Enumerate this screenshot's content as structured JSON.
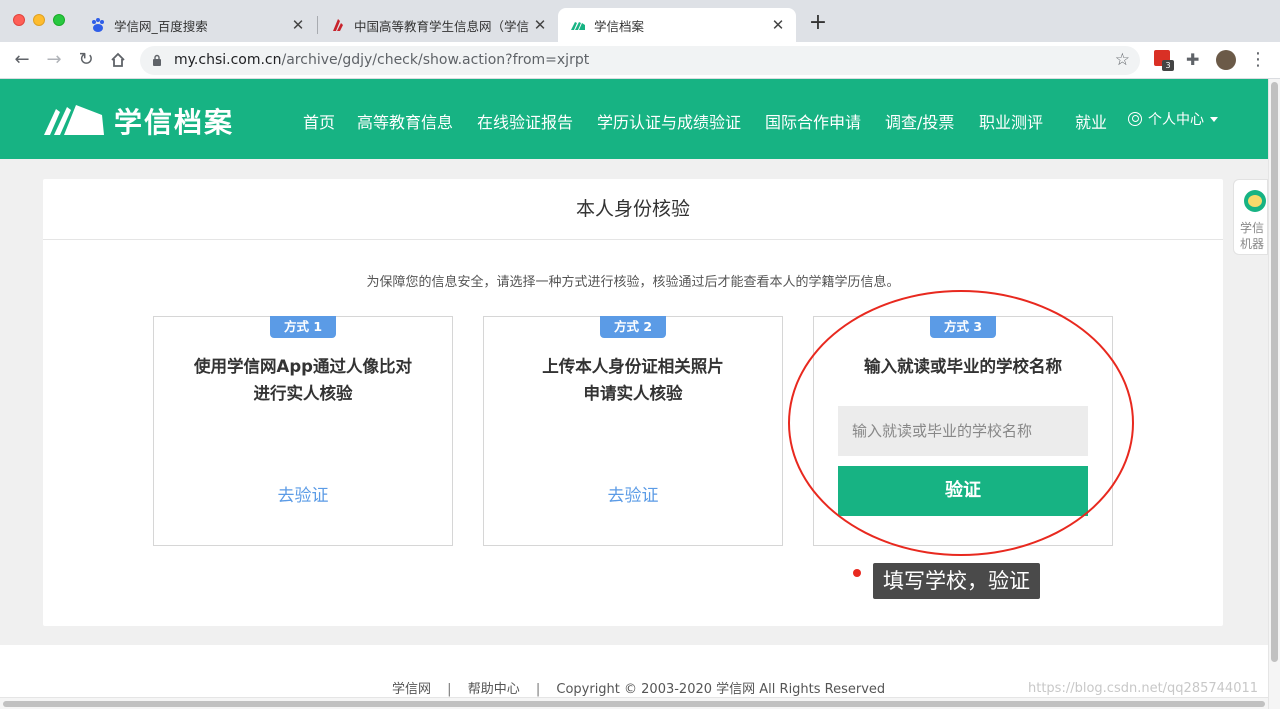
{
  "browser": {
    "tabs": [
      {
        "title": "学信网_百度搜索",
        "favicon": "baidu-paw-icon"
      },
      {
        "title": "中国高等教育学生信息网（学信",
        "favicon": "chsi-logo-icon"
      },
      {
        "title": "学信档案",
        "favicon": "xuexin-archive-icon",
        "active": true
      }
    ],
    "url_domain": "my.chsi.com.cn",
    "url_path": "/archive/gdjy/check/show.action?from=xjrpt",
    "extension_badge": "3"
  },
  "header": {
    "logo_text": "学信档案",
    "menu": [
      "首页",
      "高等教育信息",
      "在线验证报告",
      "学历认证与成绩验证",
      "国际合作申请",
      "调查/投票",
      "职业测评",
      "就业"
    ],
    "user_center": "个人中心",
    "brand_color": "#17b383"
  },
  "card": {
    "title": "本人身份核验",
    "intro": "为保障您的信息安全，请选择一种方式进行核验，核验通过后才能查看本人的学籍学历信息。",
    "methods": [
      {
        "badge": "方式 1",
        "title_line1": "使用学信网App通过人像比对",
        "title_line2": "进行实人核验",
        "action": "去验证"
      },
      {
        "badge": "方式 2",
        "title_line1": "上传本人身份证相关照片",
        "title_line2": "申请实人核验",
        "action": "去验证"
      },
      {
        "badge": "方式 3",
        "title_line1": "输入就读或毕业的学校名称",
        "input_placeholder": "输入就读或毕业的学校名称",
        "button": "验证"
      }
    ]
  },
  "annotation": {
    "tip": "填写学校，验证",
    "color": "#e8291f"
  },
  "side_widget": {
    "line1": "学信",
    "line2": "机器"
  },
  "footer": {
    "link1": "学信网",
    "separator": "|",
    "link2": "帮助中心",
    "copyright": "Copyright © 2003-2020 学信网 All Rights Reserved"
  },
  "watermark": "https://blog.csdn.net/qq285744011"
}
